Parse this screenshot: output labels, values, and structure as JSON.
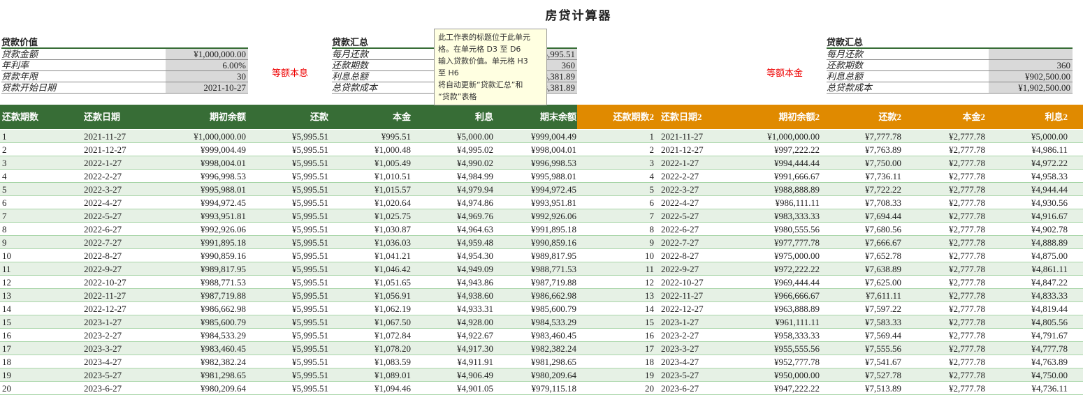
{
  "title": "房贷计算器",
  "loan_value": {
    "header": "贷款价值",
    "rows": [
      {
        "label": "贷款金额",
        "value": "¥1,000,000.00"
      },
      {
        "label": "年利率",
        "value": "6.00%"
      },
      {
        "label": "贷款年限",
        "value": "30"
      },
      {
        "label": "贷款开始日期",
        "value": "2021-10-27"
      }
    ]
  },
  "summary1": {
    "method": "等额本息",
    "header": "贷款汇总",
    "rows": [
      {
        "label": "每月还款",
        "value": "¥5,995.51"
      },
      {
        "label": "还款期数",
        "value": "360"
      },
      {
        "label": "利息总额",
        "value": "¥1,158,381.89"
      },
      {
        "label": "总贷款成本",
        "value": "¥2,158,381.89"
      }
    ]
  },
  "summary2": {
    "method": "等额本金",
    "header": "贷款汇总",
    "rows": [
      {
        "label": "每月还款",
        "value": ""
      },
      {
        "label": "还款期数",
        "value": "360"
      },
      {
        "label": "利息总额",
        "value": "¥902,500.00"
      },
      {
        "label": "总贷款成本",
        "value": "¥1,902,500.00"
      }
    ]
  },
  "tooltip": {
    "lines": [
      "此工作表的标题位于此单元",
      "格。在单元格 D3 至 D6",
      "输入贷款价值。单元格 H3",
      "至 H6",
      "将自动更新“贷款汇总”和",
      "“贷款”表格"
    ]
  },
  "colors": {
    "green": "#376d36",
    "orange": "#e08a00"
  },
  "table1": {
    "headers": [
      "还款期数",
      "还款日期",
      "期初余额",
      "还款",
      "本金",
      "利息",
      "期末余额"
    ],
    "rows": [
      [
        "1",
        "2021-11-27",
        "¥1,000,000.00",
        "¥5,995.51",
        "¥995.51",
        "¥5,000.00",
        "¥999,004.49"
      ],
      [
        "2",
        "2021-12-27",
        "¥999,004.49",
        "¥5,995.51",
        "¥1,000.48",
        "¥4,995.02",
        "¥998,004.01"
      ],
      [
        "3",
        "2022-1-27",
        "¥998,004.01",
        "¥5,995.51",
        "¥1,005.49",
        "¥4,990.02",
        "¥996,998.53"
      ],
      [
        "4",
        "2022-2-27",
        "¥996,998.53",
        "¥5,995.51",
        "¥1,010.51",
        "¥4,984.99",
        "¥995,988.01"
      ],
      [
        "5",
        "2022-3-27",
        "¥995,988.01",
        "¥5,995.51",
        "¥1,015.57",
        "¥4,979.94",
        "¥994,972.45"
      ],
      [
        "6",
        "2022-4-27",
        "¥994,972.45",
        "¥5,995.51",
        "¥1,020.64",
        "¥4,974.86",
        "¥993,951.81"
      ],
      [
        "7",
        "2022-5-27",
        "¥993,951.81",
        "¥5,995.51",
        "¥1,025.75",
        "¥4,969.76",
        "¥992,926.06"
      ],
      [
        "8",
        "2022-6-27",
        "¥992,926.06",
        "¥5,995.51",
        "¥1,030.87",
        "¥4,964.63",
        "¥991,895.18"
      ],
      [
        "9",
        "2022-7-27",
        "¥991,895.18",
        "¥5,995.51",
        "¥1,036.03",
        "¥4,959.48",
        "¥990,859.16"
      ],
      [
        "10",
        "2022-8-27",
        "¥990,859.16",
        "¥5,995.51",
        "¥1,041.21",
        "¥4,954.30",
        "¥989,817.95"
      ],
      [
        "11",
        "2022-9-27",
        "¥989,817.95",
        "¥5,995.51",
        "¥1,046.42",
        "¥4,949.09",
        "¥988,771.53"
      ],
      [
        "12",
        "2022-10-27",
        "¥988,771.53",
        "¥5,995.51",
        "¥1,051.65",
        "¥4,943.86",
        "¥987,719.88"
      ],
      [
        "13",
        "2022-11-27",
        "¥987,719.88",
        "¥5,995.51",
        "¥1,056.91",
        "¥4,938.60",
        "¥986,662.98"
      ],
      [
        "14",
        "2022-12-27",
        "¥986,662.98",
        "¥5,995.51",
        "¥1,062.19",
        "¥4,933.31",
        "¥985,600.79"
      ],
      [
        "15",
        "2023-1-27",
        "¥985,600.79",
        "¥5,995.51",
        "¥1,067.50",
        "¥4,928.00",
        "¥984,533.29"
      ],
      [
        "16",
        "2023-2-27",
        "¥984,533.29",
        "¥5,995.51",
        "¥1,072.84",
        "¥4,922.67",
        "¥983,460.45"
      ],
      [
        "17",
        "2023-3-27",
        "¥983,460.45",
        "¥5,995.51",
        "¥1,078.20",
        "¥4,917.30",
        "¥982,382.24"
      ],
      [
        "18",
        "2023-4-27",
        "¥982,382.24",
        "¥5,995.51",
        "¥1,083.59",
        "¥4,911.91",
        "¥981,298.65"
      ],
      [
        "19",
        "2023-5-27",
        "¥981,298.65",
        "¥5,995.51",
        "¥1,089.01",
        "¥4,906.49",
        "¥980,209.64"
      ],
      [
        "20",
        "2023-6-27",
        "¥980,209.64",
        "¥5,995.51",
        "¥1,094.46",
        "¥4,901.05",
        "¥979,115.18"
      ]
    ]
  },
  "table2": {
    "headers": [
      "还款期数2",
      "还款日期2",
      "期初余额2",
      "还款2",
      "本金2",
      "利息2"
    ],
    "rows": [
      [
        "1",
        "2021-11-27",
        "¥1,000,000.00",
        "¥7,777.78",
        "¥2,777.78",
        "¥5,000.00"
      ],
      [
        "2",
        "2021-12-27",
        "¥997,222.22",
        "¥7,763.89",
        "¥2,777.78",
        "¥4,986.11"
      ],
      [
        "3",
        "2022-1-27",
        "¥994,444.44",
        "¥7,750.00",
        "¥2,777.78",
        "¥4,972.22"
      ],
      [
        "4",
        "2022-2-27",
        "¥991,666.67",
        "¥7,736.11",
        "¥2,777.78",
        "¥4,958.33"
      ],
      [
        "5",
        "2022-3-27",
        "¥988,888.89",
        "¥7,722.22",
        "¥2,777.78",
        "¥4,944.44"
      ],
      [
        "6",
        "2022-4-27",
        "¥986,111.11",
        "¥7,708.33",
        "¥2,777.78",
        "¥4,930.56"
      ],
      [
        "7",
        "2022-5-27",
        "¥983,333.33",
        "¥7,694.44",
        "¥2,777.78",
        "¥4,916.67"
      ],
      [
        "8",
        "2022-6-27",
        "¥980,555.56",
        "¥7,680.56",
        "¥2,777.78",
        "¥4,902.78"
      ],
      [
        "9",
        "2022-7-27",
        "¥977,777.78",
        "¥7,666.67",
        "¥2,777.78",
        "¥4,888.89"
      ],
      [
        "10",
        "2022-8-27",
        "¥975,000.00",
        "¥7,652.78",
        "¥2,777.78",
        "¥4,875.00"
      ],
      [
        "11",
        "2022-9-27",
        "¥972,222.22",
        "¥7,638.89",
        "¥2,777.78",
        "¥4,861.11"
      ],
      [
        "12",
        "2022-10-27",
        "¥969,444.44",
        "¥7,625.00",
        "¥2,777.78",
        "¥4,847.22"
      ],
      [
        "13",
        "2022-11-27",
        "¥966,666.67",
        "¥7,611.11",
        "¥2,777.78",
        "¥4,833.33"
      ],
      [
        "14",
        "2022-12-27",
        "¥963,888.89",
        "¥7,597.22",
        "¥2,777.78",
        "¥4,819.44"
      ],
      [
        "15",
        "2023-1-27",
        "¥961,111.11",
        "¥7,583.33",
        "¥2,777.78",
        "¥4,805.56"
      ],
      [
        "16",
        "2023-2-27",
        "¥958,333.33",
        "¥7,569.44",
        "¥2,777.78",
        "¥4,791.67"
      ],
      [
        "17",
        "2023-3-27",
        "¥955,555.56",
        "¥7,555.56",
        "¥2,777.78",
        "¥4,777.78"
      ],
      [
        "18",
        "2023-4-27",
        "¥952,777.78",
        "¥7,541.67",
        "¥2,777.78",
        "¥4,763.89"
      ],
      [
        "19",
        "2023-5-27",
        "¥950,000.00",
        "¥7,527.78",
        "¥2,777.78",
        "¥4,750.00"
      ],
      [
        "20",
        "2023-6-27",
        "¥947,222.22",
        "¥7,513.89",
        "¥2,777.78",
        "¥4,736.11"
      ]
    ]
  }
}
